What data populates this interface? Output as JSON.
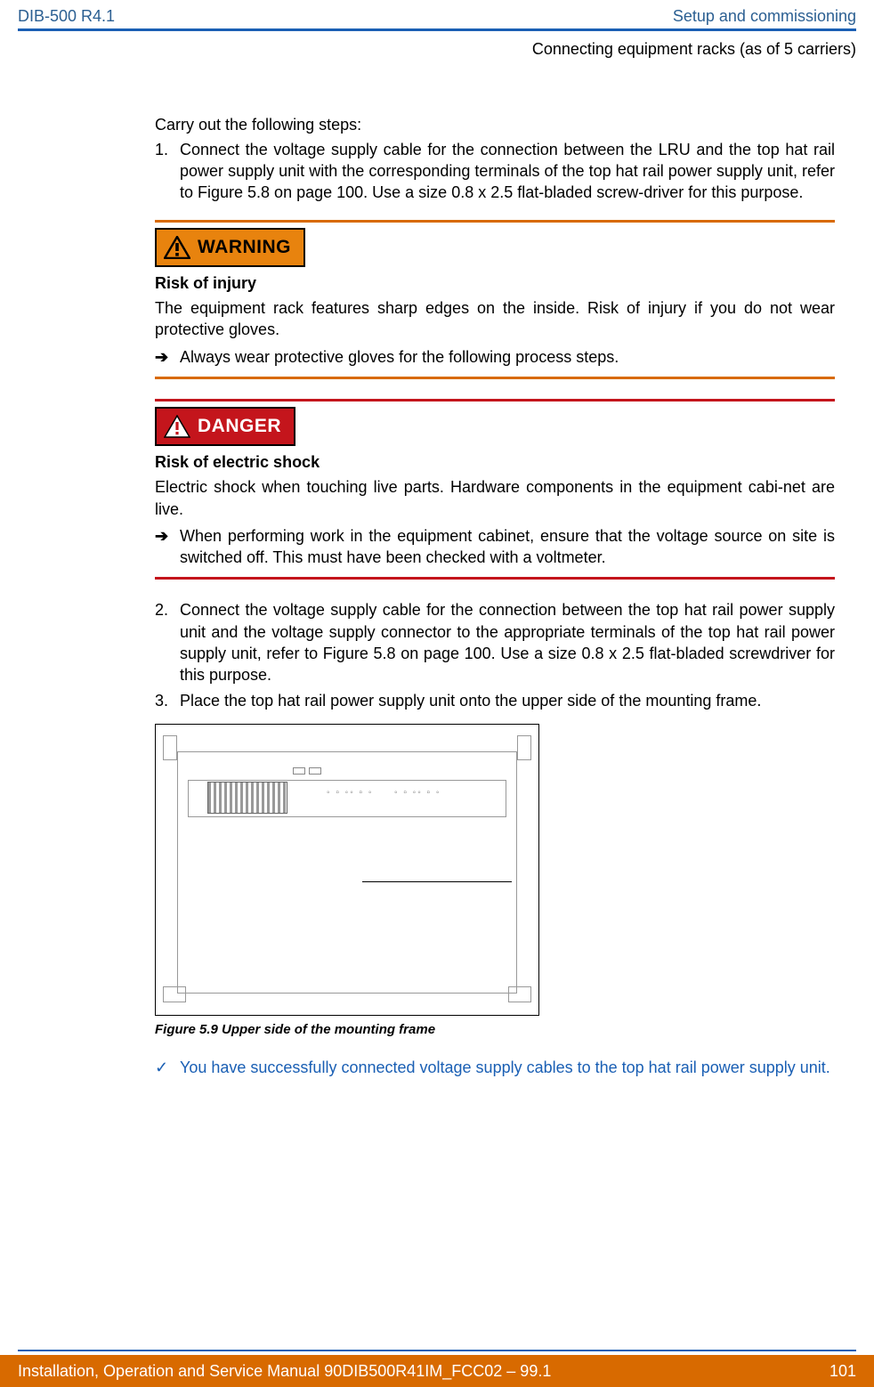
{
  "header": {
    "left": "DIB-500 R4.1",
    "right": "Setup and commissioning",
    "sub": "Connecting equipment racks (as of 5 carriers)"
  },
  "intro": "Carry out the following steps:",
  "steps_a": [
    {
      "n": "1.",
      "t": "Connect the voltage supply cable for the connection between the LRU and the top hat rail power supply unit with the corresponding terminals of the top hat rail power supply unit, refer to Figure 5.8 on page 100. Use a size 0.8 x 2.5 flat-bladed screw-driver for this purpose."
    }
  ],
  "warning": {
    "badge": "WARNING",
    "title": "Risk of injury",
    "body": "The equipment rack features sharp edges on the inside. Risk of injury if you do not wear protective gloves.",
    "arrow": "Always wear protective gloves for the following process steps."
  },
  "danger": {
    "badge": "DANGER",
    "title": "Risk of electric shock",
    "body": "Electric shock when touching live parts. Hardware components in the equipment cabi-net are live.",
    "arrow": "When performing work in the equipment cabinet, ensure that the voltage source on site is switched off. This must have been checked with a voltmeter."
  },
  "steps_b": [
    {
      "n": "2.",
      "t": "Connect the voltage supply cable for the connection between the top hat rail power supply unit and the voltage supply connector to the appropriate terminals of the top hat rail power supply unit, refer to Figure 5.8 on page 100. Use a size 0.8 x 2.5 flat-bladed screwdriver for this purpose."
    },
    {
      "n": "3.",
      "t": "Place the top hat rail power supply unit onto the upper side of the mounting frame."
    }
  ],
  "caption": "Figure 5.9 Upper side of the mounting frame",
  "success": "You have successfully connected voltage supply cables to the top hat rail power supply unit.",
  "footer": {
    "left": "Installation, Operation and Service Manual 90DIB500R41IM_FCC02 – 99.1",
    "right": "101"
  }
}
